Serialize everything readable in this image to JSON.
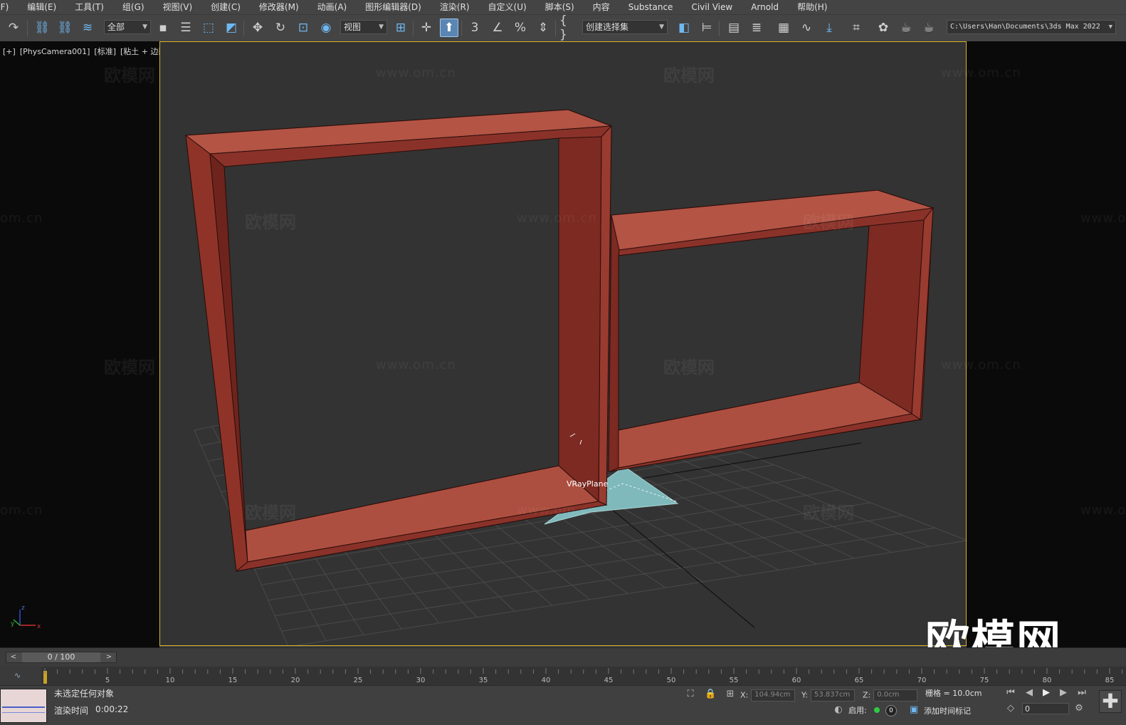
{
  "menu": [
    "(F)",
    "编辑(E)",
    "工具(T)",
    "组(G)",
    "视图(V)",
    "创建(C)",
    "修改器(M)",
    "动画(A)",
    "图形编辑器(D)",
    "渲染(R)",
    "自定义(U)",
    "脚本(S)",
    "内容",
    "Substance",
    "Civil View",
    "Arnold",
    "帮助(H)"
  ],
  "toolbar": {
    "selection_filter": "全部",
    "ref_coord": "视图",
    "named_selection": "创建选择集",
    "project_path": "C:\\Users\\Han\\Documents\\3ds Max 2022"
  },
  "viewport": {
    "label_parts": [
      "[+]",
      "[PhysCamera001]",
      "[标准]",
      "[粘土 + 边面]"
    ],
    "object_label": "VRayPlane",
    "watermark_cn": "欧模网",
    "watermark_url": "www.om.cn",
    "watermark_fragment": "om.cn",
    "logo_text": "欧模网"
  },
  "axis": {
    "x": "x",
    "y": "y",
    "z": "z"
  },
  "timeline": {
    "slider_label": "0 / 100",
    "ticks": [
      "5",
      "10",
      "15",
      "20",
      "25",
      "30",
      "35",
      "40",
      "45",
      "50",
      "55",
      "60",
      "65",
      "70",
      "75",
      "80",
      "85"
    ]
  },
  "status": {
    "selection": "未选定任何对象",
    "render_time_label": "渲染时间",
    "render_time": "0:00:22",
    "x_label": "X:",
    "x_value": "104.94cm",
    "y_label": "Y:",
    "y_value": "53.837cm",
    "z_label": "Z:",
    "z_value": "0.0cm",
    "grid": "栅格 = 10.0cm",
    "enable_label": "启用:",
    "enable_count": "0",
    "add_time_tag": "添加时间标记",
    "frame_field": "0"
  },
  "colors": {
    "frame_front": "#a84a3c",
    "frame_side": "#7c2a22",
    "plane": "#7fb9bb",
    "viewport_border": "#d6b526"
  }
}
